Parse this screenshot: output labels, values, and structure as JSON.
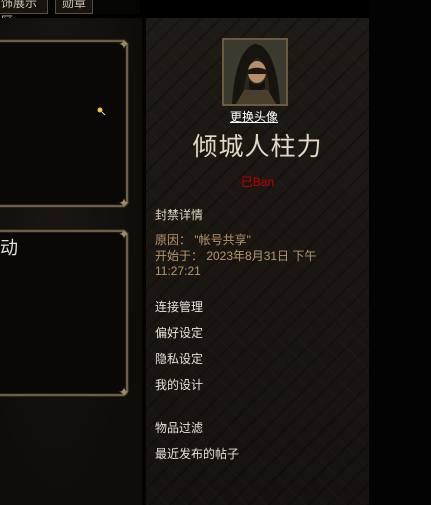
{
  "top_tabs": {
    "showcase": "饰展示区",
    "badges": "勋章"
  },
  "left_panels": {
    "panel2_heading": "动"
  },
  "profile": {
    "avatar_icon": "hooded-warrior-avatar",
    "change_avatar_label": "更换头像",
    "username": "倾城人柱力",
    "ban_status": "已Ban"
  },
  "ban_details": {
    "title": "封禁详情",
    "reason": "原因： \"帐号共享\"",
    "start": "开始于： 2023年8月31日 下午 11:27:21"
  },
  "menu": {
    "connections": "连接管理",
    "preferences": "偏好设定",
    "privacy": "隐私设定",
    "my_designs": "我的设计",
    "item_filter": "物品过滤",
    "recent_posts": "最近发布的帖子"
  },
  "colors": {
    "ban_red": "#c40000",
    "gold_text": "#b69768",
    "frame_gold": "#6e5f44"
  }
}
